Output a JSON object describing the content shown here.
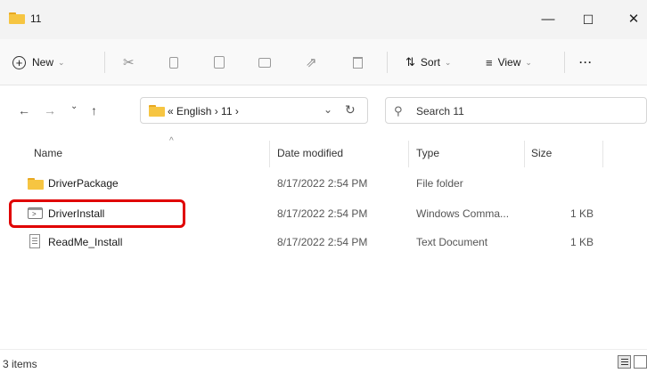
{
  "window": {
    "title": "11"
  },
  "controls": {
    "minimize": "—",
    "maximize": "☐",
    "close": "✕"
  },
  "toolbar": {
    "new_label": "New",
    "sort_label": "Sort",
    "view_label": "View",
    "more_label": "···",
    "icons": [
      "cut-icon",
      "copy-icon",
      "paste-icon",
      "rename-icon",
      "share-icon",
      "delete-icon"
    ]
  },
  "nav": {
    "back": "←",
    "forward": "→",
    "recent": "⌄",
    "up": "↑",
    "address_path": "« English  ›  11  ›",
    "dropdown": "⌄",
    "refresh": "↻",
    "search_placeholder": "Search 11"
  },
  "columns": {
    "name": "Name",
    "date": "Date modified",
    "type": "Type",
    "size": "Size"
  },
  "files": [
    {
      "name": "DriverPackage",
      "date": "8/17/2022 2:54 PM",
      "type": "File folder",
      "size": "",
      "icon": "folder-icon"
    },
    {
      "name": "DriverInstall",
      "date": "8/17/2022 2:54 PM",
      "type": "Windows Comma...",
      "size": "1 KB",
      "icon": "cmd-file-icon"
    },
    {
      "name": "ReadMe_Install",
      "date": "8/17/2022 2:54 PM",
      "type": "Text Document",
      "size": "1 KB",
      "icon": "text-file-icon"
    }
  ],
  "status": {
    "item_count": "3 items"
  },
  "colors": {
    "highlight": "#e00000",
    "folder": "#f6c542"
  }
}
